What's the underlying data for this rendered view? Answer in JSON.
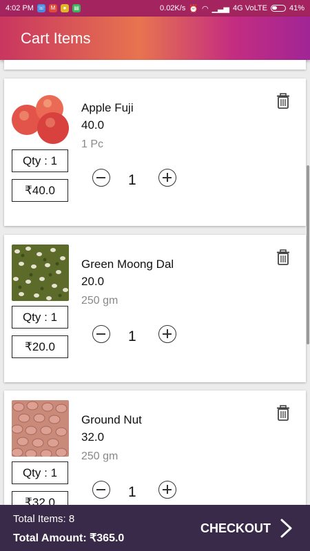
{
  "status_bar": {
    "time": "4:02 PM",
    "speed": "0.02K/s",
    "network": "4G VoLTE",
    "battery": "41%"
  },
  "app_bar": {
    "title": "Cart Items"
  },
  "cart": {
    "items": [
      {
        "name": "Apple Fuji",
        "price": "40.0",
        "unit": "1 Pc",
        "qty_label": "Qty : 1",
        "total_label": "₹40.0",
        "qty": "1",
        "image": "apple-image"
      },
      {
        "name": "Green Moong Dal",
        "price": "20.0",
        "unit": "250 gm",
        "qty_label": "Qty : 1",
        "total_label": "₹20.0",
        "qty": "1",
        "image": "moong-dal-image"
      },
      {
        "name": "Ground Nut",
        "price": "32.0",
        "unit": "250 gm",
        "qty_label": "Qty : 1",
        "total_label": "₹32.0",
        "qty": "1",
        "image": "groundnut-image"
      }
    ]
  },
  "footer": {
    "total_items": "Total Items: 8",
    "total_amount": "Total Amount: ₹365.0",
    "checkout_label": "CHECKOUT"
  },
  "colors": {
    "status_bar": "#a3245e",
    "app_bar_gradient": [
      "#c9365f",
      "#e7744f",
      "#c42d80",
      "#a12596"
    ],
    "footer_bg": "#3a2a4a"
  },
  "icons": [
    "delete-icon",
    "minus-icon",
    "plus-icon",
    "chevron-right-icon"
  ]
}
